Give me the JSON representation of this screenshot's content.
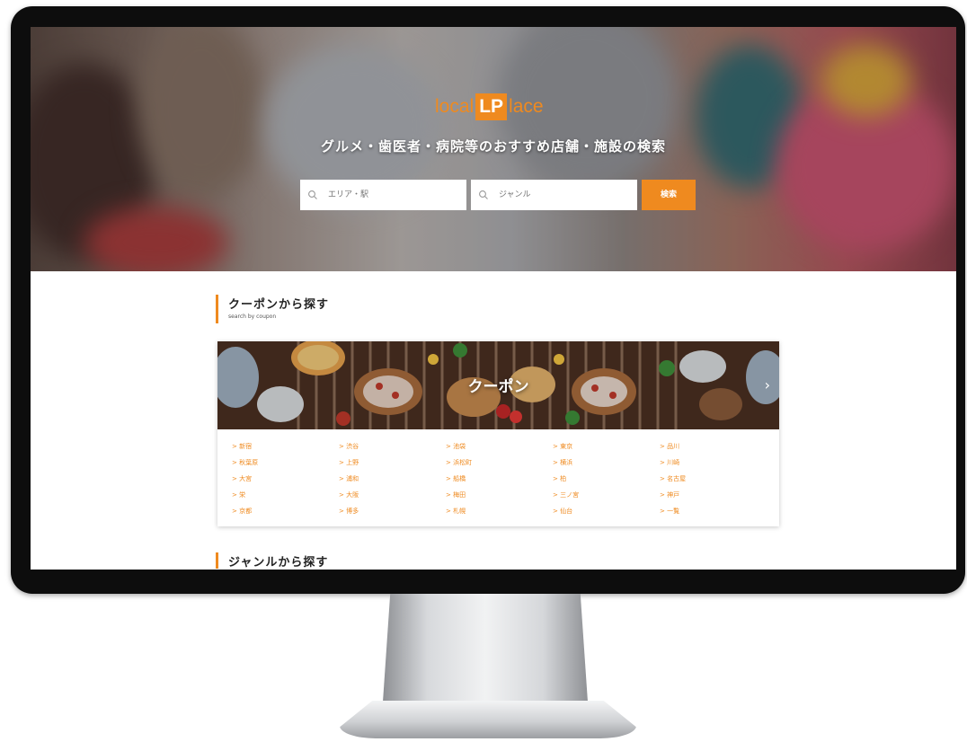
{
  "brand": {
    "logo_left": "local",
    "logo_box": "LP",
    "logo_right": "lace",
    "accent_color": "#ef8a1f"
  },
  "hero": {
    "title": "グルメ・歯医者・病院等のおすすめ店舗・施設の検索"
  },
  "search": {
    "area_placeholder": "エリア・駅",
    "genre_placeholder": "ジャンル",
    "button_label": "検索",
    "icon": "search-icon"
  },
  "coupon_section": {
    "title": "クーポンから探す",
    "subtitle": "search by coupon",
    "banner_title": "クーポン",
    "next_arrow": "›",
    "areas": [
      "> 新宿",
      "> 渋谷",
      "> 池袋",
      "> 東京",
      "> 品川",
      "> 秋葉原",
      "> 上野",
      "> 浜松町",
      "> 横浜",
      "> 川崎",
      "> 大宮",
      "> 浦和",
      "> 船橋",
      "> 柏",
      "> 名古屋",
      "> 栄",
      "> 大阪",
      "> 梅田",
      "> 三ノ宮",
      "> 神戸",
      "> 京都",
      "> 博多",
      "> 札幌",
      "> 仙台",
      "> 一覧"
    ]
  },
  "genre_section": {
    "title": "ジャンルから探す"
  }
}
